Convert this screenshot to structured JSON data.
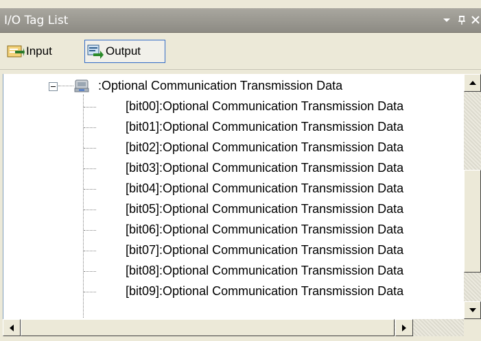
{
  "window": {
    "title": "I/O Tag List",
    "controls": [
      "dropdown-arrow-icon",
      "pin-icon",
      "close-icon"
    ]
  },
  "toolbar": {
    "input_label": "Input",
    "output_label": "Output",
    "active": "output"
  },
  "tree": {
    "root_label": ":Optional Communication Transmission Data",
    "root_state": "expanded",
    "items": [
      "[bit00]:Optional Communication Transmission Data",
      "[bit01]:Optional Communication Transmission Data",
      "[bit02]:Optional Communication Transmission Data",
      "[bit03]:Optional Communication Transmission Data",
      "[bit04]:Optional Communication Transmission Data",
      "[bit05]:Optional Communication Transmission Data",
      "[bit06]:Optional Communication Transmission Data",
      "[bit07]:Optional Communication Transmission Data",
      "[bit08]:Optional Communication Transmission Data",
      "[bit09]:Optional Communication Transmission Data"
    ]
  },
  "colors": {
    "titlebar": "#9c9a92",
    "panel": "#ece9d8",
    "active_border": "#316ac5"
  }
}
